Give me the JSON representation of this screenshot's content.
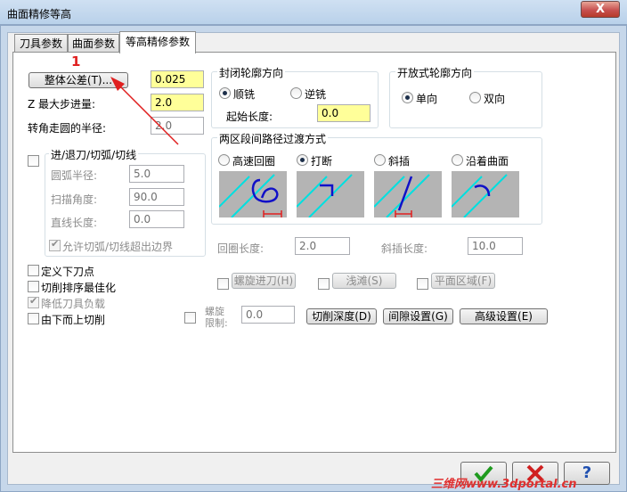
{
  "window": {
    "title": "曲面精修等高",
    "close_glyph": "X"
  },
  "tabs": [
    {
      "label": "刀具参数"
    },
    {
      "label": "曲面参数"
    },
    {
      "label": "等高精修参数"
    }
  ],
  "left": {
    "tolerance_button": "整体公差(T)...",
    "tolerance_value": "0.025",
    "z_step_label": "Z 最大步进量:",
    "z_step_value": "2.0",
    "corner_radius_label": "转角走圆的半径:",
    "corner_radius_value": "2.0",
    "entry_group_label": "进/退刀/切弧/切线",
    "arc_radius_label": "圆弧半径:",
    "arc_radius_value": "5.0",
    "sweep_angle_label": "扫描角度:",
    "sweep_angle_value": "90.0",
    "line_length_label": "直线长度:",
    "line_length_value": "0.0",
    "allow_exceed_label": "允许切弧/切线超出边界",
    "options": [
      {
        "label": "定义下刀点"
      },
      {
        "label": "切削排序最佳化"
      },
      {
        "label": "降低刀具负载"
      },
      {
        "label": "由下而上切削"
      }
    ]
  },
  "closed_contour": {
    "label": "封闭轮廓方向",
    "climb": "顺铣",
    "conventional": "逆铣",
    "start_length_label": "起始长度:",
    "start_length_value": "0.0"
  },
  "open_contour": {
    "label": "开放式轮廓方向",
    "one_way": "单向",
    "two_way": "双向"
  },
  "transition": {
    "label": "两区段间路径过渡方式",
    "options": [
      {
        "label": "高速回圈"
      },
      {
        "label": "打断"
      },
      {
        "label": "斜插"
      },
      {
        "label": "沿着曲面"
      }
    ],
    "loop_length_label": "回圈长度:",
    "loop_length_value": "2.0",
    "ramp_length_label": "斜插长度:",
    "ramp_length_value": "10.0"
  },
  "bottom": {
    "helix_entry": "螺旋进刀(H)",
    "shallow": "浅滩(S)",
    "flat_area": "平面区域(F)",
    "helix_limit_label_1": "螺旋",
    "helix_limit_label_2": "限制:",
    "helix_limit_value": "0.0",
    "cut_depth": "切削深度(D)",
    "gap_settings": "间隙设置(G)",
    "advanced": "高级设置(E)"
  },
  "dialog": {
    "help_glyph": "?"
  },
  "annotation": {
    "number": "1"
  },
  "watermark": {
    "text": "三维网www.3dportal.cn"
  },
  "colors": {
    "highlight_field": "#ffff99",
    "annotation": "#e02020",
    "tool_path": "#1010c8",
    "stock_edge": "#00e0e0"
  }
}
